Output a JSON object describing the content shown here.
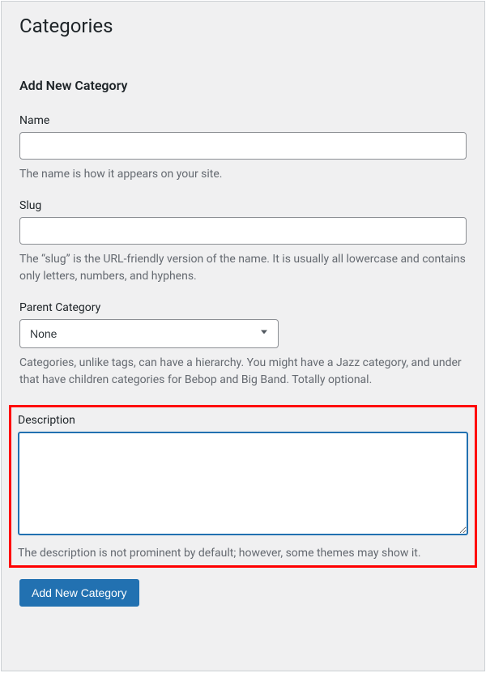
{
  "page": {
    "title": "Categories",
    "section_title": "Add New Category"
  },
  "fields": {
    "name": {
      "label": "Name",
      "value": "",
      "help": "The name is how it appears on your site."
    },
    "slug": {
      "label": "Slug",
      "value": "",
      "help": "The “slug” is the URL-friendly version of the name. It is usually all lowercase and contains only letters, numbers, and hyphens."
    },
    "parent": {
      "label": "Parent Category",
      "selected": "None",
      "help": "Categories, unlike tags, can have a hierarchy. You might have a Jazz category, and under that have children categories for Bebop and Big Band. Totally optional."
    },
    "description": {
      "label": "Description",
      "value": "",
      "help": "The description is not prominent by default; however, some themes may show it."
    }
  },
  "buttons": {
    "submit": "Add New Category"
  }
}
